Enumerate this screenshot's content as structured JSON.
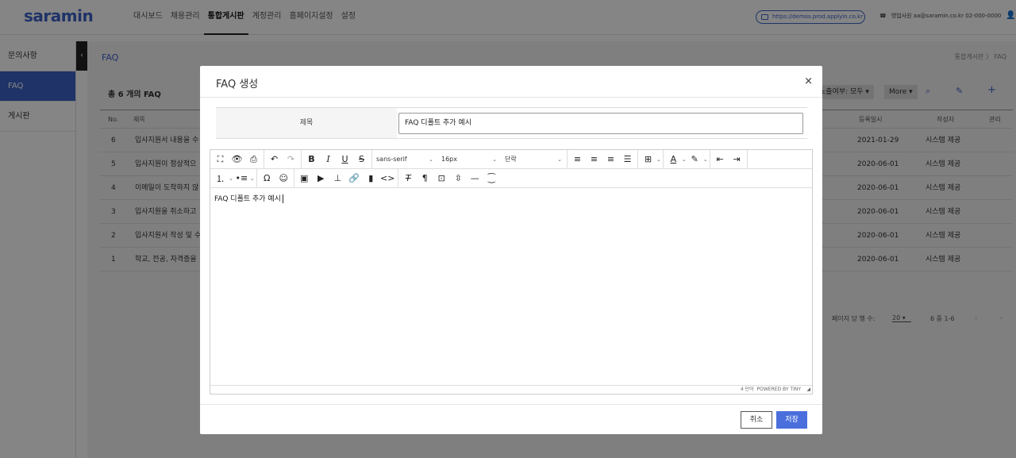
{
  "header": {
    "logo": "saramin",
    "nav": [
      "대시보드",
      "채용관리",
      "통합게시판",
      "계정관리",
      "홈페이지설정",
      "설정"
    ],
    "url": "https://demos.prod.applyin.co.kr",
    "user_info": "영업사원 aa@saramin.co.kr 02-000-0000"
  },
  "sidebar": {
    "items": [
      "문의사항",
      "FAQ",
      "게시판"
    ],
    "collapse": "‹"
  },
  "main": {
    "title": "FAQ",
    "breadcrumb": "통합게시판 〉 FAQ",
    "count_label": "총 6 개의 FAQ",
    "filter_label": "노출여부: 모두 ▾",
    "more_label": "More ▾",
    "columns": {
      "no": "No.",
      "title": "제목",
      "date": "등록일시",
      "author": "작성자",
      "manage": "관리"
    },
    "rows": [
      {
        "no": "6",
        "title": "입사지원서 내용을 수",
        "date": "2021-01-29",
        "author": "시스템 제공"
      },
      {
        "no": "5",
        "title": "입사지원이 정상적으",
        "date": "2020-06-01",
        "author": "시스템 제공"
      },
      {
        "no": "4",
        "title": "이메일이 도착하지 않",
        "date": "2020-06-01",
        "author": "시스템 제공"
      },
      {
        "no": "3",
        "title": "입사지원을 취소하고",
        "date": "2020-06-01",
        "author": "시스템 제공"
      },
      {
        "no": "2",
        "title": "입사지원서 작성 및 수",
        "date": "2020-06-01",
        "author": "시스템 제공"
      },
      {
        "no": "1",
        "title": "학교, 전공, 자격증을",
        "date": "2020-06-01",
        "author": "시스템 제공"
      }
    ],
    "per_page_label": "페이지 당 행 수:",
    "per_page_value": "20",
    "range": "6 중 1-6"
  },
  "modal": {
    "title": "FAQ 생성",
    "close": "×",
    "title_label": "제목",
    "title_value": "FAQ 디폴트 추가 예시",
    "editor": {
      "font_family": "sans-serif",
      "font_size": "16px",
      "block_format": "단락",
      "content": "FAQ 디폴트 추가 예시",
      "word_count": "4 단어",
      "powered_by": "POWERED BY TINY"
    },
    "cancel_label": "취소",
    "save_label": "저장"
  },
  "colors": {
    "accent": "#3d63c8",
    "save_button": "#4a6fdc",
    "overlay": "rgba(0,0,0,0.48)"
  }
}
